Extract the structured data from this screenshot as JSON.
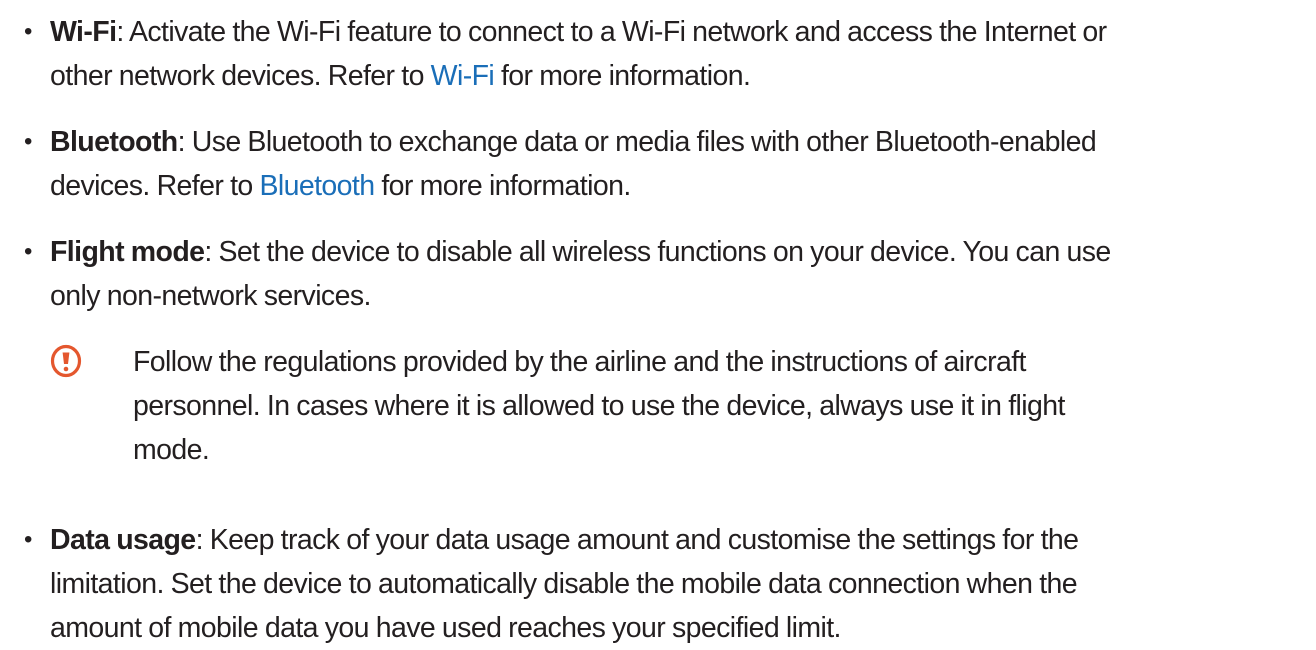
{
  "items": [
    {
      "term": "Wi-Fi",
      "line1": ": Activate the Wi-Fi feature to connect to a Wi-Fi network and access the Internet or",
      "line2_pre": "other network devices. Refer to ",
      "link": "Wi-Fi",
      "line2_post": " for more information."
    },
    {
      "term": "Bluetooth",
      "line1": ": Use Bluetooth to exchange data or media files with other Bluetooth-enabled",
      "line2_pre": "devices. Refer to ",
      "link": "Bluetooth",
      "line2_post": " for more information."
    },
    {
      "term": "Flight mode",
      "line1": ": Set the device to disable all wireless functions on your device. You can use",
      "line2": "only non-network services."
    },
    {
      "term": "Data usage",
      "line1": ": Keep track of your data usage amount and customise the settings for the",
      "line2": "limitation. Set the device to automatically disable the mobile data connection when the",
      "line3": "amount of mobile data you have used reaches your specified limit."
    }
  ],
  "caution": {
    "icon": "caution-icon",
    "icon_color": "#e4572e",
    "line1": "Follow the regulations provided by the airline and the instructions of aircraft",
    "line2": "personnel. In cases where it is allowed to use the device, always use it in flight",
    "line3": "mode."
  },
  "colors": {
    "text": "#231f20",
    "link": "#1a6eb8"
  }
}
